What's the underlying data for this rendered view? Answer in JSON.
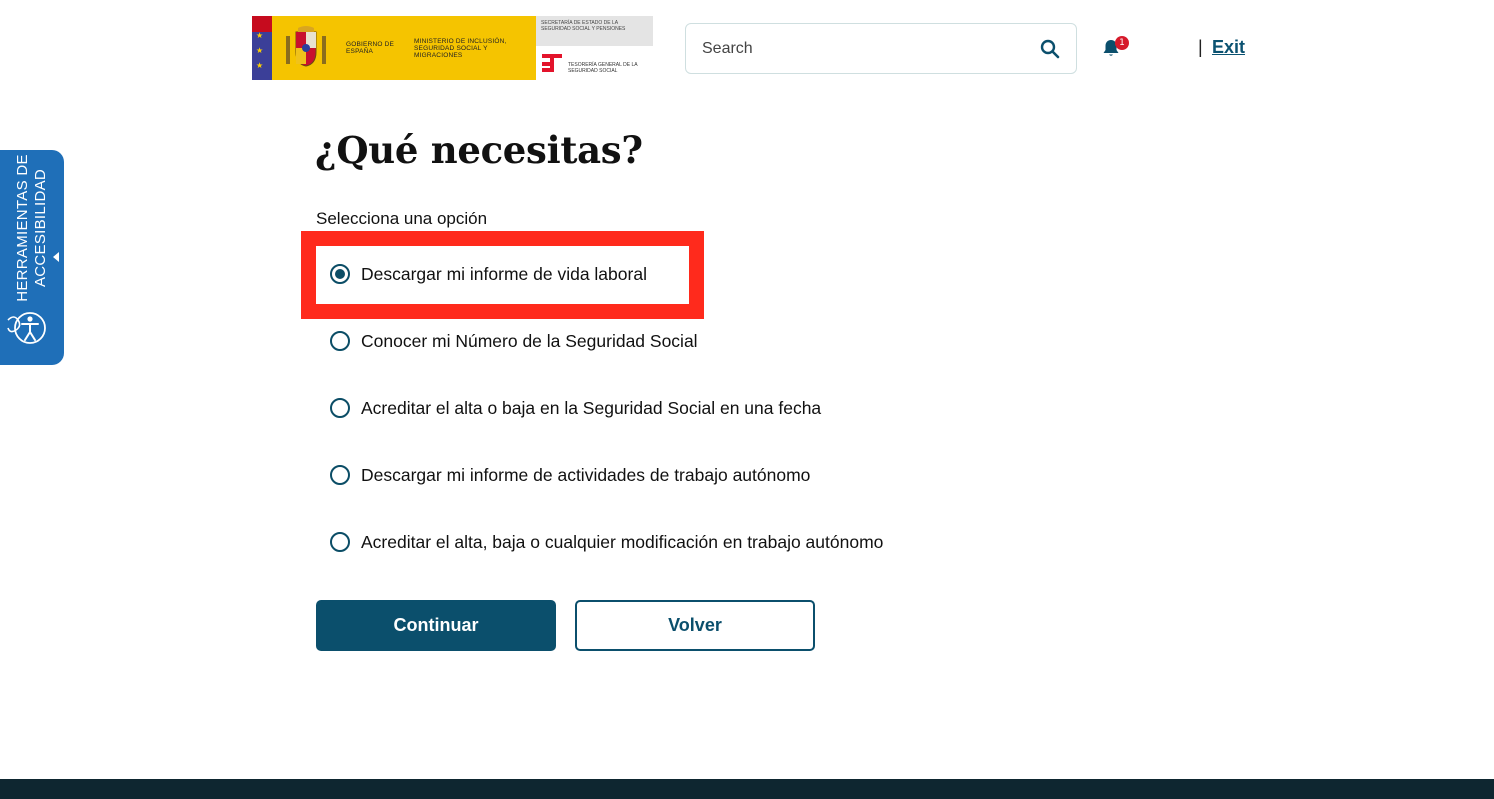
{
  "header": {
    "logo": {
      "gov_text": "GOBIERNO DE ESPAÑA",
      "ministry_text": "MINISTERIO DE INCLUSIÓN, SEGURIDAD SOCIAL Y MIGRACIONES",
      "secretariat_text": "SECRETARÍA DE ESTADO DE LA SEGURIDAD SOCIAL Y PENSIONES",
      "treasury_text": "TESORERÍA GENERAL DE LA SEGURIDAD SOCIAL"
    },
    "search": {
      "placeholder": "Search",
      "value": ""
    },
    "notifications": {
      "count": "1"
    },
    "separator": "|",
    "exit_label": "Exit"
  },
  "accessibility_tab": {
    "label_line1": "HERRAMIENTAS DE",
    "label_line2": "ACCESIBILIDAD"
  },
  "main": {
    "title": "¿Qué necesitas?",
    "subtitle": "Selecciona una opción",
    "options": [
      {
        "label": "Descargar mi informe de vida laboral",
        "selected": true
      },
      {
        "label": "Conocer mi Número de la Seguridad Social",
        "selected": false
      },
      {
        "label": "Acreditar el alta o baja en la Seguridad Social en una fecha",
        "selected": false
      },
      {
        "label": "Descargar mi informe de actividades de trabajo autónomo",
        "selected": false
      },
      {
        "label": "Acreditar el alta, baja o cualquier modificación en trabajo autónomo",
        "selected": false
      }
    ],
    "continue_label": "Continuar",
    "back_label": "Volver"
  },
  "colors": {
    "primary": "#0b4f6c",
    "highlight": "#ff2a1c",
    "a11y_tab": "#1f6fb8",
    "badge": "#d61a2b"
  }
}
